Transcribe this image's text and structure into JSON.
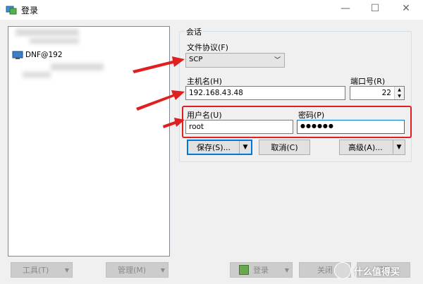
{
  "window": {
    "title": "登录",
    "minimize": "—",
    "maximize": "☐",
    "close": "✕"
  },
  "sites": {
    "selected": "DNF@192"
  },
  "session": {
    "group_label": "会话",
    "protocol_label": "文件协议(F)",
    "protocol_value": "SCP",
    "host_label": "主机名(H)",
    "host_value": "192.168.43.48",
    "port_label": "端口号(R)",
    "port_value": "22",
    "user_label": "用户名(U)",
    "user_value": "root",
    "password_label": "密码(P)",
    "password_value": "●●●●●●"
  },
  "buttons": {
    "save": "保存(S)...",
    "cancel": "取消(C)",
    "advanced": "高级(A)...",
    "tools": "工具(T)",
    "manage": "管理(M)",
    "login": "登录",
    "close": "关闭",
    "help": "帮助"
  },
  "watermark": {
    "text": "什么值得买"
  },
  "colors": {
    "highlight": "#e02020",
    "arrow": "#e02020",
    "focus": "#0078d7"
  }
}
